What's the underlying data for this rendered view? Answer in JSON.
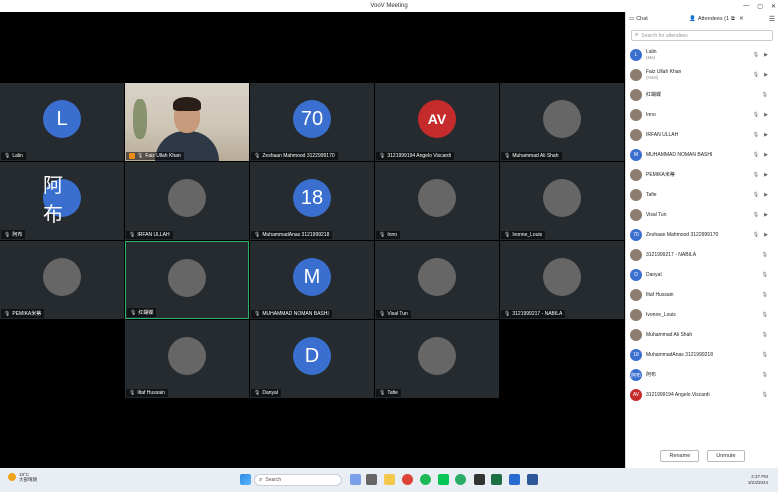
{
  "window": {
    "title": "VooV Meeting",
    "controls": [
      "—",
      "▢",
      "✕"
    ]
  },
  "tiles": [
    {
      "name": "Lalin",
      "avatar": "L",
      "type": "letter",
      "row": 0,
      "col": 0
    },
    {
      "name": "Faiz Ullah Khan",
      "avatar": "",
      "type": "video",
      "host": true,
      "row": 0,
      "col": 1
    },
    {
      "name": "Zeshaan Mahmood 3122999170",
      "avatar": "70",
      "type": "letter",
      "row": 0,
      "col": 2
    },
    {
      "name": "3121999194 Angelo Viscardi",
      "avatar": "AV",
      "type": "logo",
      "row": 0,
      "col": 3
    },
    {
      "name": "Muhammad Ali Shah",
      "avatar": "",
      "type": "photo",
      "row": 0,
      "col": 4
    },
    {
      "name": "阿布",
      "avatar": "阿布",
      "type": "letter",
      "row": 1,
      "col": 0
    },
    {
      "name": "IRFAN ULLAH",
      "avatar": "",
      "type": "photo",
      "row": 1,
      "col": 1
    },
    {
      "name": "MuhammadAnas 3121999218",
      "avatar": "18",
      "type": "letter",
      "row": 1,
      "col": 2
    },
    {
      "name": "Inno",
      "avatar": "",
      "type": "photo",
      "row": 1,
      "col": 3
    },
    {
      "name": "Ivonne_Louis",
      "avatar": "",
      "type": "photo",
      "row": 1,
      "col": 4
    },
    {
      "name": "PEMIKA米蒂",
      "avatar": "",
      "type": "photo",
      "row": 2,
      "col": 0
    },
    {
      "name": "红蝴蝶",
      "avatar": "",
      "type": "photo",
      "row": 2,
      "col": 1,
      "selected": true
    },
    {
      "name": "MUHAMMAD NOMAN BASHI",
      "avatar": "M",
      "type": "letter",
      "row": 2,
      "col": 2
    },
    {
      "name": "Visal Tun",
      "avatar": "",
      "type": "photo",
      "row": 2,
      "col": 3
    },
    {
      "name": "3121999217 - NABILA",
      "avatar": "",
      "type": "photo",
      "row": 2,
      "col": 4
    },
    {
      "name": "Iltaf Hussain",
      "avatar": "",
      "type": "photo",
      "row": 3,
      "col": 1
    },
    {
      "name": "Danyal",
      "avatar": "D",
      "type": "letter",
      "row": 3,
      "col": 2
    },
    {
      "name": "Tafie",
      "avatar": "",
      "type": "photo",
      "row": 3,
      "col": 3
    }
  ],
  "panel": {
    "chat_tab": "Chat",
    "attendees_tab": "Attendees (1",
    "search_placeholder": "Search for attendees",
    "attendees": [
      {
        "name": "Lalin",
        "sub": "(Me)",
        "avatar": "L",
        "type": "letter",
        "video": true
      },
      {
        "name": "Faiz Ullah Khan",
        "sub": "(Host)",
        "avatar": "",
        "type": "photo",
        "video": true
      },
      {
        "name": "红蝴蝶",
        "sub": "",
        "avatar": "",
        "type": "photo",
        "video": false
      },
      {
        "name": "Inno",
        "sub": "",
        "avatar": "",
        "type": "photo",
        "video": true
      },
      {
        "name": "IRFAN ULLAH",
        "sub": "",
        "avatar": "",
        "type": "photo",
        "video": true
      },
      {
        "name": "MUHAMMAD NOMAN BASHI",
        "sub": "",
        "avatar": "M",
        "type": "letter",
        "video": true
      },
      {
        "name": "PEMIKA米蒂",
        "sub": "",
        "avatar": "",
        "type": "photo",
        "video": true
      },
      {
        "name": "Tafie",
        "sub": "",
        "avatar": "",
        "type": "photo",
        "video": true
      },
      {
        "name": "Visal Tun",
        "sub": "",
        "avatar": "",
        "type": "photo",
        "video": true
      },
      {
        "name": "Zeshaan Mahmood 3122999170",
        "sub": "",
        "avatar": "70",
        "type": "letter",
        "video": true
      },
      {
        "name": "3121999217 - NABILA",
        "sub": "",
        "avatar": "",
        "type": "photo",
        "video": false
      },
      {
        "name": "Danyal",
        "sub": "",
        "avatar": "D",
        "type": "letter",
        "video": false
      },
      {
        "name": "Iltaf Hussain",
        "sub": "",
        "avatar": "",
        "type": "photo",
        "video": false
      },
      {
        "name": "Ivonne_Louis",
        "sub": "",
        "avatar": "",
        "type": "photo",
        "video": false
      },
      {
        "name": "Muhammad Ali Shah",
        "sub": "",
        "avatar": "",
        "type": "photo",
        "video": false
      },
      {
        "name": "MuhammadAnas 3121999218",
        "sub": "",
        "avatar": "18",
        "type": "letter",
        "video": false
      },
      {
        "name": "阿布",
        "sub": "",
        "avatar": "阿布",
        "type": "letter",
        "video": false
      },
      {
        "name": "3121999194 Angelo Viscardi",
        "sub": "",
        "avatar": "AV",
        "type": "logo",
        "video": false
      }
    ],
    "rename_label": "Rename",
    "unmute_label": "Unmute"
  },
  "taskbar": {
    "weather_temp": "18°C",
    "weather_desc": "大部晴朗",
    "search_placeholder": "Search",
    "time": "2:37 PM",
    "date": "3/23/2024"
  },
  "colors": {
    "accent": "#3a6fcf",
    "selected_border": "#2fb36a",
    "tile_bg": "#262b30"
  }
}
